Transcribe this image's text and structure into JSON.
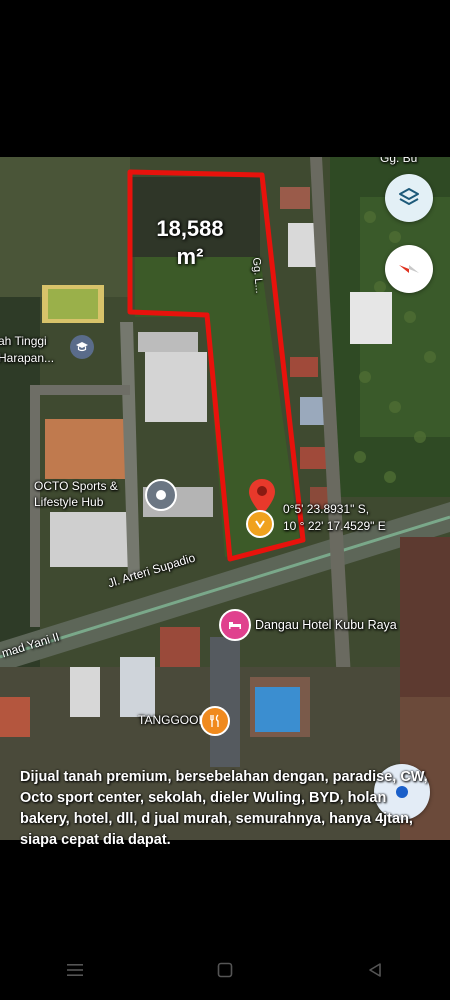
{
  "map": {
    "area_value": "18,588",
    "area_unit": "m²",
    "labels": {
      "school": "ah Tinggi\nHarapan...",
      "octo": "OCTO Sports &\nLifestyle Hub",
      "road_main": "Jl. Arteri Supadio",
      "road_yani": "mad Yani II",
      "hotel": "Dangau Hotel Kubu Raya",
      "tanggooe": "TANGGOOE",
      "coord_lat": "0°5' 23.8931\" S,",
      "coord_lon": "10 ° 22' 17.4529\" E",
      "street_top": "Gg. Bu",
      "street_side": "Gg. L..."
    },
    "colors": {
      "boundary": "#e8120c",
      "pin": "#e8392b",
      "hotel_poi": "#e0418e",
      "food_poi": "#f08a1e"
    },
    "buttons": {
      "layers": "layers-icon",
      "compass": "compass-icon",
      "location": "my-location-icon"
    }
  },
  "caption": "Dijual tanah premium, bersebelahan dengan, paradise, CW, Octo sport center, sekolah, dieler Wuling, BYD, holan bakery, hotel, dll, d jual murah, semurahnya, hanya 4jtan, siapa cepat dia dapat.",
  "navbar": {
    "recent": "menu-icon",
    "home": "square-icon",
    "back": "triangle-back-icon"
  }
}
